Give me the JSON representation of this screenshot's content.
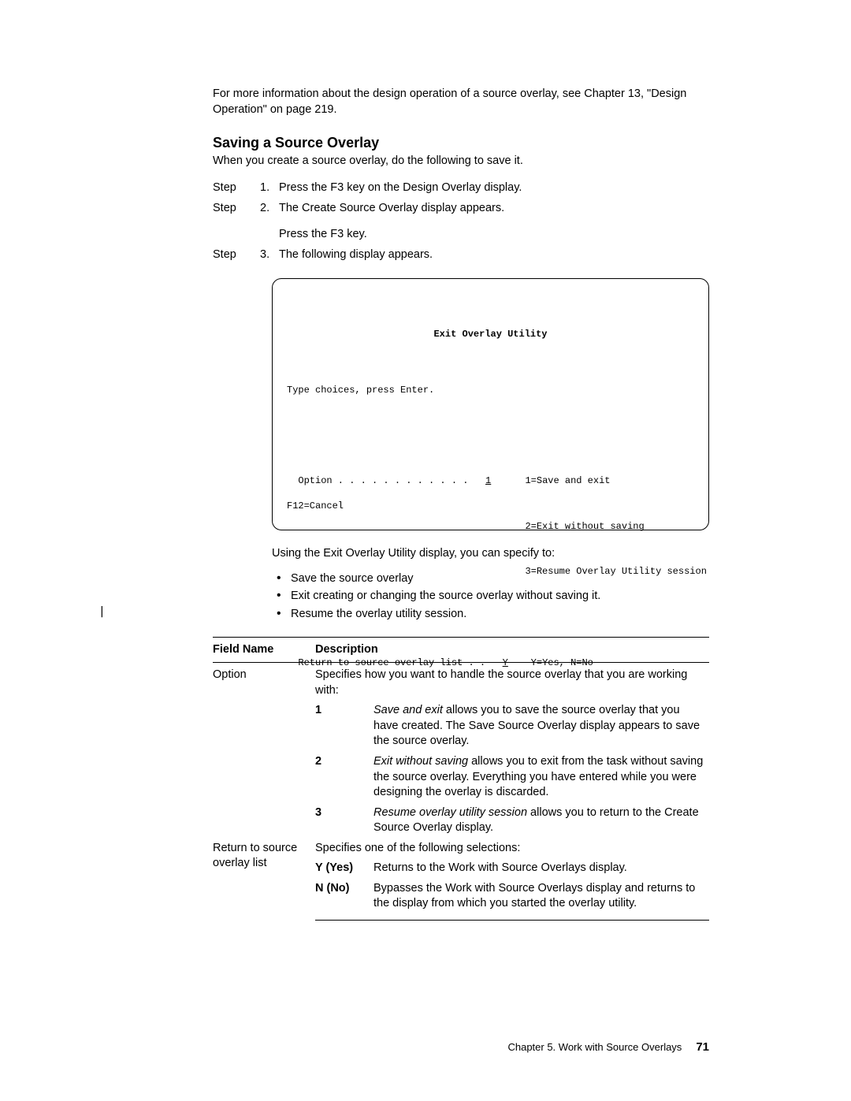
{
  "intro": "For more information about the design operation of a source overlay, see Chapter 13, \"Design Operation\" on page 219.",
  "section_heading": "Saving a Source Overlay",
  "section_lead": "When you create a source overlay, do the following to save it.",
  "change_bar": "|",
  "steps": {
    "label": "Step",
    "items": [
      {
        "num": "1.",
        "text": "Press the F3 key on the Design Overlay display."
      },
      {
        "num": "2.",
        "text": "The Create Source Overlay display appears.",
        "subtext": "Press the F3 key."
      },
      {
        "num": "3.",
        "text": "The following display appears."
      }
    ]
  },
  "terminal": {
    "title": "Exit Overlay Utility",
    "line_choices": "Type choices, press Enter.",
    "option_label": "  Option . . . . . . . . . . . .   ",
    "option_value": "1",
    "option_d1": "1=Save and exit",
    "option_d2": "2=Exit without saving",
    "option_d3": "3=Resume Overlay Utility session",
    "return_label": "  Return to source overlay list . .   ",
    "return_value": "Y",
    "return_help": "Y=Yes, N=No",
    "footer": "F12=Cancel"
  },
  "after_screen": "Using the Exit Overlay Utility display, you can specify to:",
  "bullets": [
    "Save the source overlay",
    "Exit creating or changing the source overlay without saving it.",
    "Resume the overlay utility session."
  ],
  "table": {
    "head_field": "Field Name",
    "head_desc": "Description",
    "option_name": "Option",
    "option_desc": "Specifies how you want to handle the source overlay that you are working with:",
    "opt1_key": "1",
    "opt1_em": "Save and exit",
    "opt1_rest": " allows you to save the source overlay that you have created.  The Save Source Overlay display appears to save the source overlay.",
    "opt2_key": "2",
    "opt2_em": "Exit without saving",
    "opt2_rest": " allows you to exit from the task without saving the source overlay.  Everything you have entered while you were designing the overlay is discarded.",
    "opt3_key": "3",
    "opt3_em": "Resume overlay utility session",
    "opt3_rest": " allows you to return to the Create Source Overlay display.",
    "return_name": "Return to source overlay list",
    "return_desc": "Specifies one of the following selections:",
    "yyes": "Y (Yes)",
    "yyes_desc": "Returns to the Work with Source Overlays display.",
    "nno": "N (No)",
    "nno_desc": "Bypasses the Work with Source Overlays display and returns to the display from which you started the overlay utility."
  },
  "footer": {
    "chapter": "Chapter 5.  Work with Source Overlays",
    "page": "71"
  }
}
